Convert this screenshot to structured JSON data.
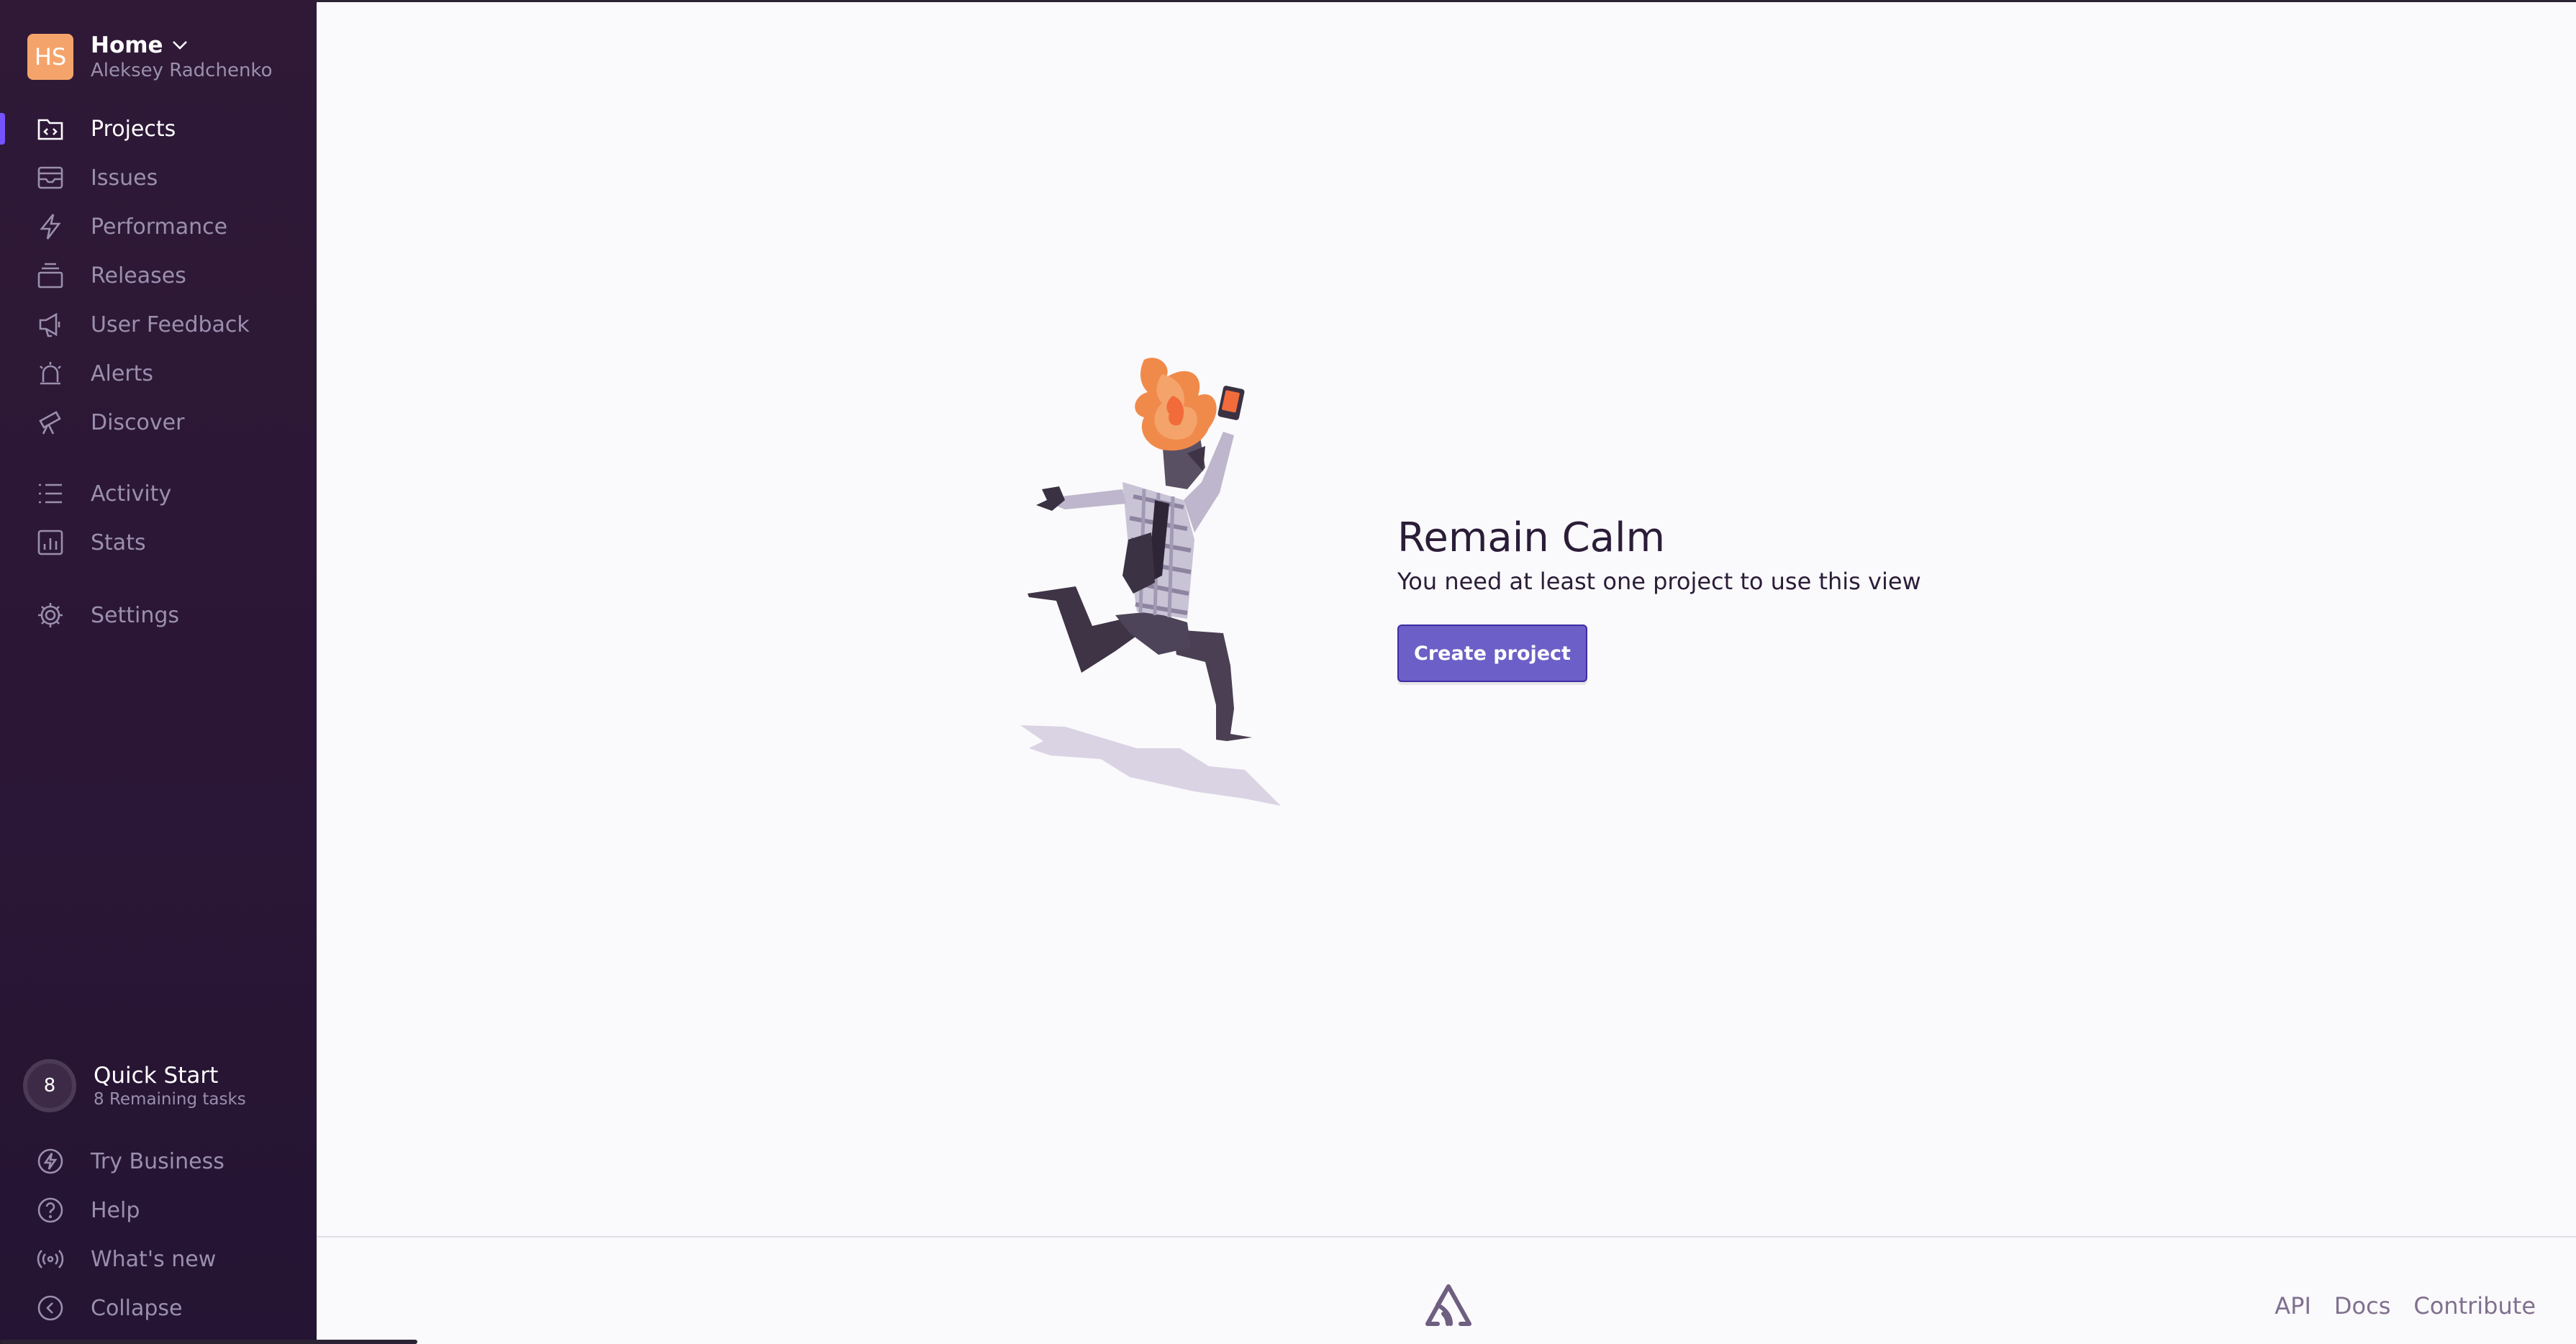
{
  "org": {
    "avatar_initials": "HS",
    "name": "Home",
    "user": "Aleksey Radchenko"
  },
  "sidebar": {
    "primary": [
      {
        "label": "Projects",
        "icon": "projects-icon",
        "active": true
      },
      {
        "label": "Issues",
        "icon": "issues-icon"
      },
      {
        "label": "Performance",
        "icon": "lightning-icon"
      },
      {
        "label": "Releases",
        "icon": "releases-icon"
      },
      {
        "label": "User Feedback",
        "icon": "megaphone-icon"
      },
      {
        "label": "Alerts",
        "icon": "siren-icon"
      },
      {
        "label": "Discover",
        "icon": "telescope-icon"
      }
    ],
    "secondary": [
      {
        "label": "Activity",
        "icon": "list-icon"
      },
      {
        "label": "Stats",
        "icon": "stats-icon"
      }
    ],
    "settings": {
      "label": "Settings",
      "icon": "gear-icon"
    },
    "quickstart": {
      "count": "8",
      "title": "Quick Start",
      "subtitle": "8 Remaining tasks"
    },
    "bottom": [
      {
        "label": "Try Business",
        "icon": "lightning-circle-icon"
      },
      {
        "label": "Help",
        "icon": "help-icon"
      },
      {
        "label": "What's new",
        "icon": "broadcast-icon"
      },
      {
        "label": "Collapse",
        "icon": "collapse-icon"
      }
    ]
  },
  "empty_state": {
    "title": "Remain Calm",
    "subtitle": "You need at least one project to use this view",
    "button_label": "Create project"
  },
  "footer": {
    "links": [
      "API",
      "Docs",
      "Contribute"
    ]
  },
  "colors": {
    "sidebar_bg": "#2F1937",
    "accent": "#6C5FC7",
    "active_indicator": "#7553FF",
    "avatar": "#F4A46B"
  }
}
